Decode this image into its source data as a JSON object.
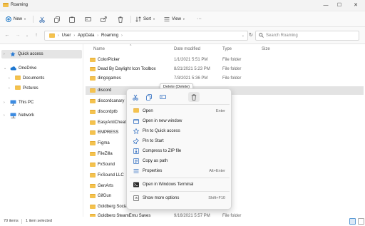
{
  "window": {
    "title": "Roaming",
    "controls": {
      "minimize": "—",
      "maximize": "☐",
      "close": "✕"
    }
  },
  "toolbar": {
    "new_label": "New",
    "sort_label": "Sort",
    "view_label": "View",
    "more_label": "···"
  },
  "address": {
    "crumbs": [
      "User",
      "AppData",
      "Roaming"
    ]
  },
  "search": {
    "placeholder": "Search Roaming"
  },
  "sidebar": {
    "items": [
      {
        "label": "Quick access",
        "icon": "star-icon",
        "selected": true
      },
      {
        "label": "OneDrive",
        "icon": "cloud-icon"
      },
      {
        "label": "Documents",
        "icon": "folder-icon"
      },
      {
        "label": "Pictures",
        "icon": "folder-icon"
      },
      {
        "label": "This PC",
        "icon": "pc-icon"
      },
      {
        "label": "Network",
        "icon": "network-icon"
      }
    ]
  },
  "columns": {
    "name": "Name",
    "date": "Date modified",
    "type": "Type",
    "size": "Size"
  },
  "files": [
    {
      "name": "ColorPicker",
      "date": "1/1/2021 5:51 PM",
      "type": "File folder"
    },
    {
      "name": "Dead By Daylight Icon Toolbox",
      "date": "8/21/2021 5:23 PM",
      "type": "File folder"
    },
    {
      "name": "dingogames",
      "date": "7/3/2021 5:36 PM",
      "type": "File folder"
    },
    {
      "name": "discord",
      "date": "",
      "type": "",
      "selected": true
    },
    {
      "name": "discordcanary",
      "date": "",
      "type": ""
    },
    {
      "name": "discordptb",
      "date": "",
      "type": ""
    },
    {
      "name": "EasyAntiCheat",
      "date": "",
      "type": ""
    },
    {
      "name": "EMPRESS",
      "date": "",
      "type": ""
    },
    {
      "name": "Figma",
      "date": "",
      "type": ""
    },
    {
      "name": "FileZilla",
      "date": "",
      "type": ""
    },
    {
      "name": "FxSound",
      "date": "",
      "type": ""
    },
    {
      "name": "FxSound LLC",
      "date": "",
      "type": ""
    },
    {
      "name": "GenArts",
      "date": "",
      "type": ""
    },
    {
      "name": "GifGun",
      "date": "",
      "type": ""
    },
    {
      "name": "Goldberg SocialCli",
      "date": "",
      "type": ""
    },
    {
      "name": "Goldberg SteamEmu Saves",
      "date": "9/16/2021 5:57 PM",
      "type": "File folder"
    }
  ],
  "status": {
    "count": "70 items",
    "selected": "1 item selected"
  },
  "tooltip": "Delete (Delete)",
  "context_menu": {
    "items": [
      {
        "label": "Open",
        "shortcut": "Enter",
        "icon": "open-icon"
      },
      {
        "label": "Open in new window",
        "shortcut": "",
        "icon": "new-window-icon"
      },
      {
        "label": "Pin to Quick access",
        "shortcut": "",
        "icon": "pin-star-icon"
      },
      {
        "label": "Pin to Start",
        "shortcut": "",
        "icon": "pin-icon"
      },
      {
        "label": "Compress to ZIP file",
        "shortcut": "",
        "icon": "zip-icon"
      },
      {
        "label": "Copy as path",
        "shortcut": "",
        "icon": "copy-path-icon"
      },
      {
        "label": "Properties",
        "shortcut": "Alt+Enter",
        "icon": "properties-icon"
      },
      {
        "label": "Open in Windows Terminal",
        "shortcut": "",
        "icon": "terminal-icon"
      },
      {
        "label": "Show more options",
        "shortcut": "Shift+F10",
        "icon": "more-options-icon"
      }
    ]
  },
  "colors": {
    "accent": "#0067c0",
    "folder": "#f4c24f",
    "selected_row": "#e3e3e3"
  }
}
